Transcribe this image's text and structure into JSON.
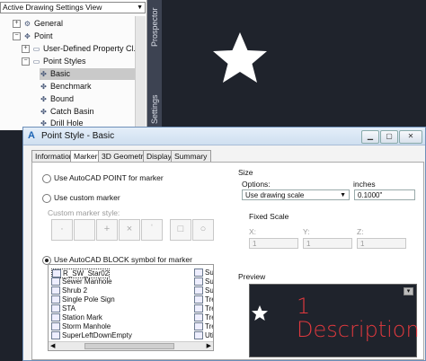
{
  "tree": {
    "view_select": "Active Drawing Settings View",
    "nodes": {
      "general": "General",
      "point": "Point",
      "user_defined": "User-Defined Property Cl...",
      "point_styles": "Point Styles",
      "basic": "Basic",
      "benchmark": "Benchmark",
      "bound": "Bound",
      "catch_basin": "Catch Basin",
      "drill_hole": "Drill Hole"
    }
  },
  "side_tabs": {
    "prospector": "Prospector",
    "settings": "Settings"
  },
  "dialog": {
    "title": "Point Style - Basic",
    "tabs": [
      "Information",
      "Marker",
      "3D Geometry",
      "Display",
      "Summary"
    ],
    "marker": {
      "opt_autocad_point": "Use AutoCAD POINT for marker",
      "opt_custom": "Use custom marker",
      "custom_style_label": "Custom marker style:",
      "custom_glyphs": [
        "·",
        " ",
        "+",
        "×",
        "ˈ",
        "□",
        "○"
      ],
      "opt_block": "Use AutoCAD BLOCK symbol for marker",
      "blocks_left": [
        "R_SW_Star02",
        "Sewer Manhole",
        "Shrub 2",
        "Single Pole Sign",
        "STA",
        "Station Mark",
        "Storm Manhole",
        "SuperLeftDownEmpty"
      ],
      "blocks_right": [
        "Sup",
        "Sup",
        "Sup",
        "Tree",
        "Tree",
        "Tree",
        "Tree",
        "Utili"
      ]
    },
    "size": {
      "group": "Size",
      "options_label": "Options:",
      "options_value": "Use drawing scale",
      "inches_label": "inches",
      "inches_value": "0.1000\"",
      "fixed_scale": "Fixed Scale",
      "x_label": "X:",
      "y_label": "Y:",
      "z_label": "Z:",
      "x_value": "1",
      "y_value": "1",
      "z_value": "1"
    },
    "preview": {
      "group": "Preview",
      "number": "1",
      "text": "Description"
    }
  },
  "colors": {
    "preview_text": "#e0393e",
    "canvas_bg": "#1f232c"
  }
}
